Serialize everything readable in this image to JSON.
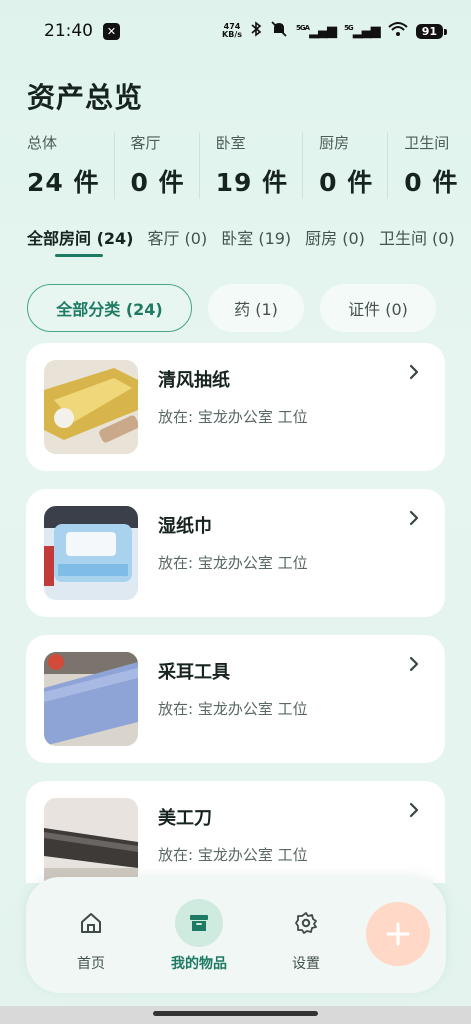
{
  "status_bar": {
    "time": "21:40",
    "net_speed_value": "474",
    "net_speed_unit": "KB/s",
    "sim1_label": "5GA",
    "sim2_label": "5G",
    "battery": "91",
    "icons": [
      "x-app-icon",
      "bluetooth-icon",
      "mute-icon",
      "signal-icon",
      "signal-icon",
      "wifi-icon",
      "battery-icon"
    ]
  },
  "page_title": "资产总览",
  "stats": [
    {
      "label": "总体",
      "value": "24 件"
    },
    {
      "label": "客厅",
      "value": "0 件"
    },
    {
      "label": "卧室",
      "value": "19 件"
    },
    {
      "label": "厨房",
      "value": "0 件"
    },
    {
      "label": "卫生间",
      "value": "0 件"
    }
  ],
  "room_tabs": [
    {
      "label": "全部房间 (24)",
      "active": true
    },
    {
      "label": "客厅 (0)",
      "active": false
    },
    {
      "label": "卧室 (19)",
      "active": false
    },
    {
      "label": "厨房 (0)",
      "active": false
    },
    {
      "label": "卫生间 (0)",
      "active": false
    }
  ],
  "categories": [
    {
      "label": "全部分类 (24)",
      "active": true
    },
    {
      "label": "药 (1)",
      "active": false
    },
    {
      "label": "证件 (0)",
      "active": false
    }
  ],
  "items": [
    {
      "name": "清风抽纸",
      "location": "放在: 宝龙办公室 工位",
      "thumb": "tissue-pack-photo"
    },
    {
      "name": "湿纸巾",
      "location": "放在: 宝龙办公室 工位",
      "thumb": "wet-wipes-photo"
    },
    {
      "name": "采耳工具",
      "location": "放在: 宝龙办公室 工位",
      "thumb": "ear-tool-photo"
    },
    {
      "name": "美工刀",
      "location": "放在: 宝龙办公室 工位",
      "thumb": "utility-knife-photo"
    }
  ],
  "bottom_nav": [
    {
      "label": "首页",
      "icon": "home-icon",
      "active": false
    },
    {
      "label": "我的物品",
      "icon": "archive-box-icon",
      "active": true
    },
    {
      "label": "设置",
      "icon": "gear-icon",
      "active": false
    }
  ],
  "fab_icon": "plus-icon",
  "colors": {
    "accent": "#1f7a63",
    "background": "#e2f3ed",
    "fab": "#ffd8c7"
  }
}
